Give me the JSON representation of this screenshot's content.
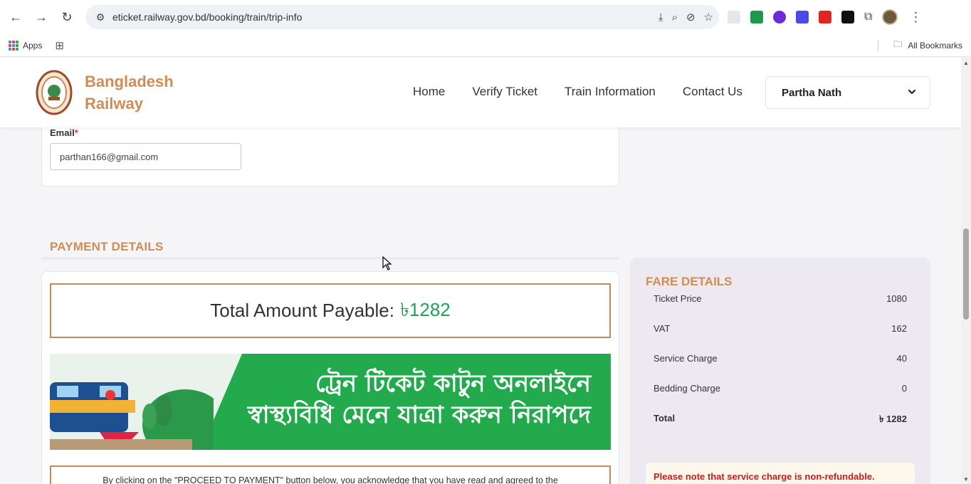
{
  "browser": {
    "url": "eticket.railway.gov.bd/booking/train/trip-info",
    "bookmarks": {
      "apps_label": "Apps",
      "all_bookmarks_label": "All Bookmarks"
    }
  },
  "header": {
    "brand_line1": "Bangladesh",
    "brand_line2": "Railway",
    "nav": [
      "Home",
      "Verify Ticket",
      "Train Information",
      "Contact Us"
    ],
    "user_name": "Partha Nath"
  },
  "contact": {
    "email_label": "Email",
    "required_mark": "*",
    "email_value": "parthan166@gmail.com"
  },
  "payment": {
    "section_title": "PAYMENT DETAILS",
    "total_label": "Total Amount Payable:",
    "total_amount": "৳1282",
    "banner_line1": "ট্রেন টিকেট কাটুন অনলাইনে",
    "banner_line2": "স্বাস্থ্যবিধি মেনে যাত্রা করুন নিরাপদে",
    "acknowledgement": "By clicking on the \"PROCEED TO PAYMENT\" button below, you acknowledge that you have read and agreed to the"
  },
  "fare": {
    "title": "FARE DETAILS",
    "rows": [
      {
        "label": "Ticket Price",
        "value": "1080"
      },
      {
        "label": "VAT",
        "value": "162"
      },
      {
        "label": "Service Charge",
        "value": "40"
      },
      {
        "label": "Bedding Charge",
        "value": "0"
      },
      {
        "label": "Total",
        "value": "৳ 1282"
      }
    ],
    "notice": "Please note that service charge is non-refundable."
  },
  "colors": {
    "accent": "#d08c54",
    "green": "#1fa356",
    "warning": "#cc1a1a"
  }
}
